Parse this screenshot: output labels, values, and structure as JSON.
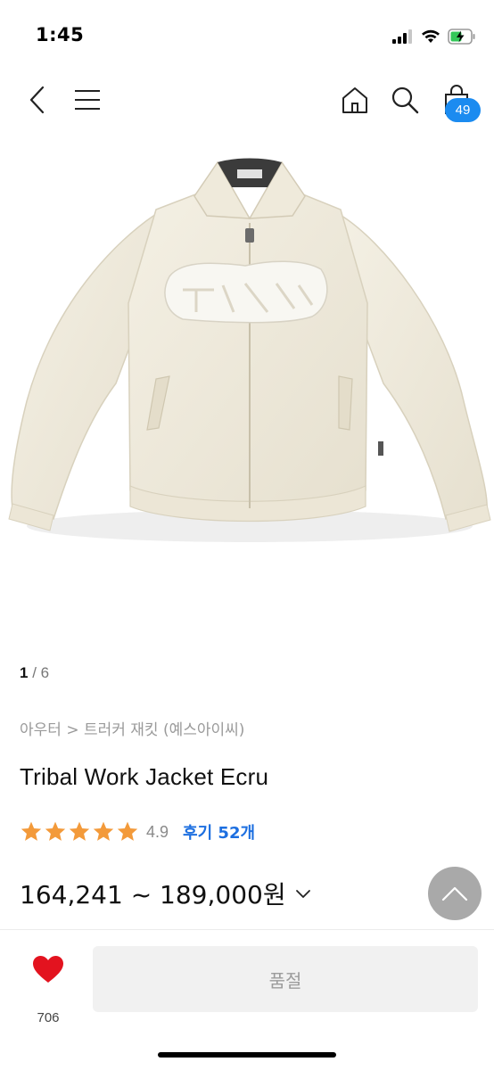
{
  "status_bar": {
    "time": "1:45",
    "battery_color": "#34c759"
  },
  "nav": {
    "back_icon": "chevron-left-icon",
    "menu_icon": "hamburger-menu-icon",
    "home_icon": "home-icon",
    "search_icon": "search-icon",
    "cart_icon": "shopping-bag-icon",
    "cart_count": "49",
    "badge_color": "#1b8bf0"
  },
  "gallery": {
    "current": "1",
    "separator": " / ",
    "total": "6"
  },
  "product": {
    "breadcrumb": "아우터 > 트러커 재킷 (예스아이씨)",
    "title": "Tribal Work Jacket Ecru",
    "rating_stars": 5,
    "rating_score": "4.9",
    "review_link": "후기 52개",
    "price": "164,241 ~ 189,000원",
    "star_color": "#f39a3a",
    "review_color": "#1d6fe0"
  },
  "bottom": {
    "like_count": "706",
    "heart_color": "#e3131f",
    "soldout_label": "품절"
  },
  "scroll_top_icon": "chevron-up-icon"
}
